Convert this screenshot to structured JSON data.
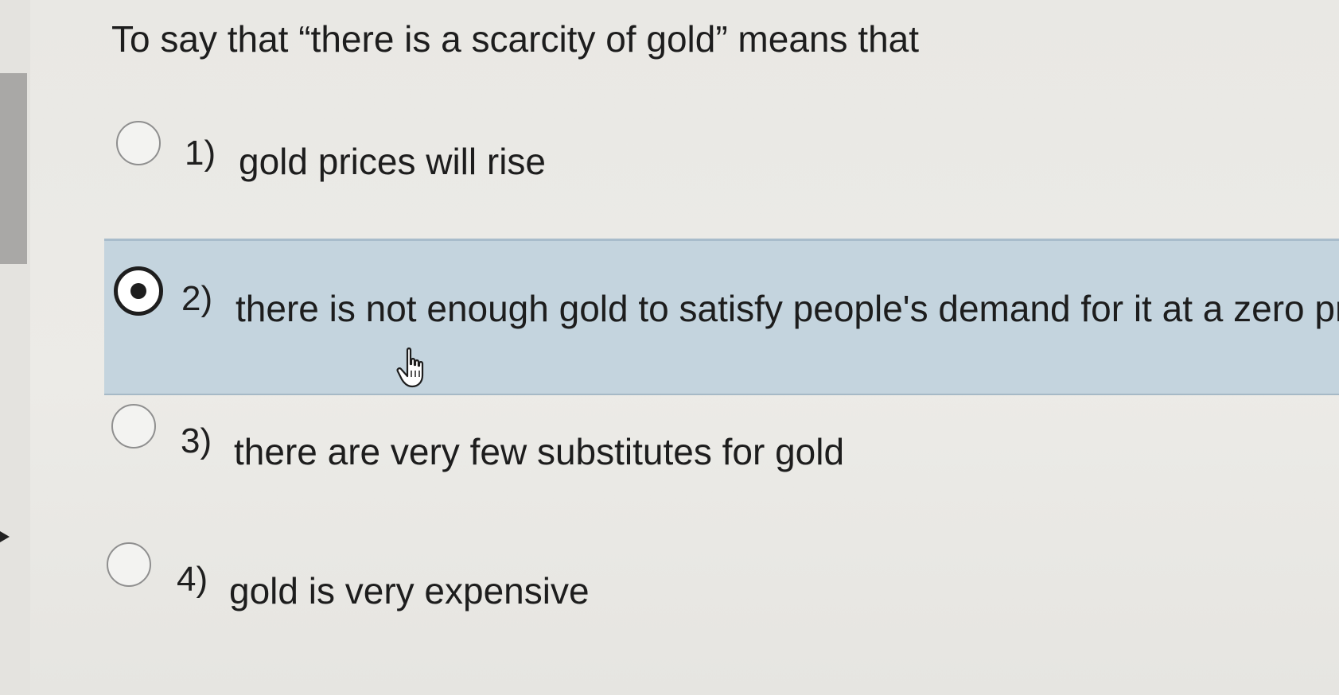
{
  "question": {
    "text": "To say that “there is a scarcity of gold” means that"
  },
  "options": [
    {
      "number": "1)",
      "text": "gold prices will rise",
      "selected": false
    },
    {
      "number": "2)",
      "text": "there is not enough gold to satisfy people's demand for it at a zero price",
      "selected": true
    },
    {
      "number": "3)",
      "text": "there are very few substitutes for gold",
      "selected": false
    },
    {
      "number": "4)",
      "text": "gold is very expensive",
      "selected": false
    }
  ],
  "colors": {
    "selected_highlight": "#c4d4de",
    "background": "#ebeae6",
    "radio_checked": "#1e1e1e"
  },
  "icons": {
    "cursor": "hand-pointer-icon",
    "radio": "radio-button-icon"
  }
}
